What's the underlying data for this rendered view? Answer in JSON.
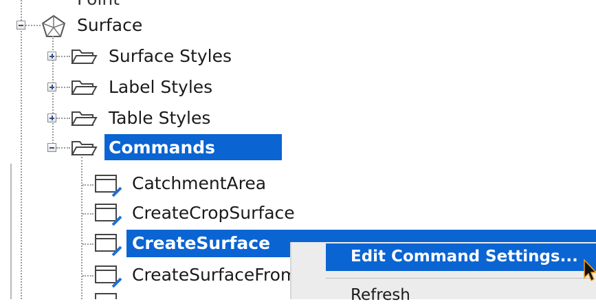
{
  "tree": {
    "top_partial_label": "Point",
    "surface": {
      "label": "Surface"
    },
    "children": [
      {
        "label": "Surface Styles"
      },
      {
        "label": "Label Styles"
      },
      {
        "label": "Table Styles"
      },
      {
        "label": "Commands"
      }
    ],
    "commands": [
      {
        "label": "CatchmentArea"
      },
      {
        "label": "CreateCropSurface"
      },
      {
        "label": "CreateSurface"
      },
      {
        "label": "CreateSurfaceFrom"
      }
    ]
  },
  "context_menu": {
    "items": [
      {
        "label": "Edit Command Settings..."
      },
      {
        "label": "Refresh"
      }
    ]
  },
  "colors": {
    "selection": "#0a64d2",
    "menu_background": "#ececec"
  },
  "icons": {
    "surface": "surface-pentagon-icon",
    "folder": "folder-open-icon",
    "command": "command-window-icon",
    "cursor": "mouse-pointer-icon"
  }
}
